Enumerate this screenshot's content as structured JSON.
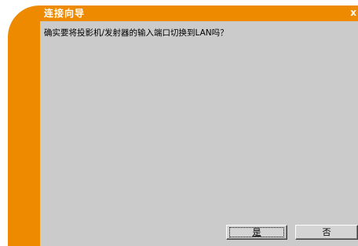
{
  "window": {
    "title": "连接向导",
    "close_glyph": "x"
  },
  "message": "确实要将投影机/发射器的输入端口切换到LAN吗？",
  "buttons": {
    "yes_label": "是",
    "no_label": "否"
  },
  "colors": {
    "frame_orange": "#ee8a00",
    "content_gray": "#cbcbcb",
    "title_text": "#ffffff"
  }
}
